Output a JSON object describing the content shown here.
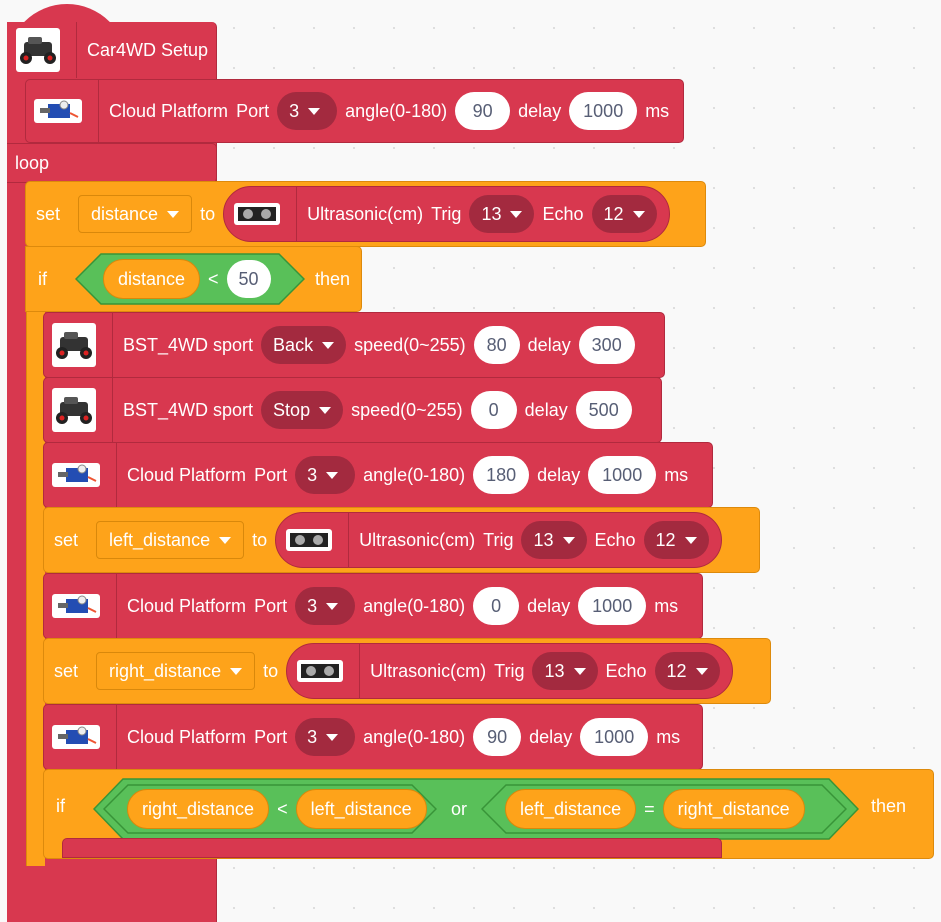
{
  "setup": {
    "label": "Car4WD Setup"
  },
  "cloud1": {
    "title": "Cloud Platform",
    "port_label": "Port",
    "port": "3",
    "angle_label": "angle(0-180)",
    "angle": "90",
    "delay_label": "delay",
    "delay": "1000",
    "unit": "ms"
  },
  "loop": {
    "label": "loop"
  },
  "set1": {
    "set": "set",
    "var": "distance",
    "to": "to",
    "sensor": "Ultrasonic(cm)",
    "trig_label": "Trig",
    "trig": "13",
    "echo_label": "Echo",
    "echo": "12"
  },
  "if1": {
    "if": "if",
    "var": "distance",
    "op": "<",
    "value": "50",
    "then": "then"
  },
  "back": {
    "title": "BST_4WD sport",
    "dir": "Back",
    "speed_label": "speed(0~255)",
    "speed": "80",
    "delay_label": "delay",
    "delay": "300"
  },
  "stop": {
    "title": "BST_4WD sport",
    "dir": "Stop",
    "speed_label": "speed(0~255)",
    "speed": "0",
    "delay_label": "delay",
    "delay": "500"
  },
  "cloud2": {
    "title": "Cloud Platform",
    "port_label": "Port",
    "port": "3",
    "angle_label": "angle(0-180)",
    "angle": "180",
    "delay_label": "delay",
    "delay": "1000",
    "unit": "ms"
  },
  "set2": {
    "set": "set",
    "var": "left_distance",
    "to": "to",
    "sensor": "Ultrasonic(cm)",
    "trig_label": "Trig",
    "trig": "13",
    "echo_label": "Echo",
    "echo": "12"
  },
  "cloud3": {
    "title": "Cloud Platform",
    "port_label": "Port",
    "port": "3",
    "angle_label": "angle(0-180)",
    "angle": "0",
    "delay_label": "delay",
    "delay": "1000",
    "unit": "ms"
  },
  "set3": {
    "set": "set",
    "var": "right_distance",
    "to": "to",
    "sensor": "Ultrasonic(cm)",
    "trig_label": "Trig",
    "trig": "13",
    "echo_label": "Echo",
    "echo": "12"
  },
  "cloud4": {
    "title": "Cloud Platform",
    "port_label": "Port",
    "port": "3",
    "angle_label": "angle(0-180)",
    "angle": "90",
    "delay_label": "delay",
    "delay": "1000",
    "unit": "ms"
  },
  "if2": {
    "if": "if",
    "a": "right_distance",
    "op1": "<",
    "b": "left_distance",
    "or": "or",
    "c": "left_distance",
    "op2": "=",
    "d": "right_distance",
    "then": "then"
  },
  "colors": {
    "red": "#d8384f",
    "dark_red": "#a32a3f",
    "orange": "#fea31a",
    "green": "#59c059"
  },
  "icons": [
    "car-icon",
    "servo-icon",
    "ultrasonic-sensor-icon",
    "dropdown-caret-icon"
  ]
}
